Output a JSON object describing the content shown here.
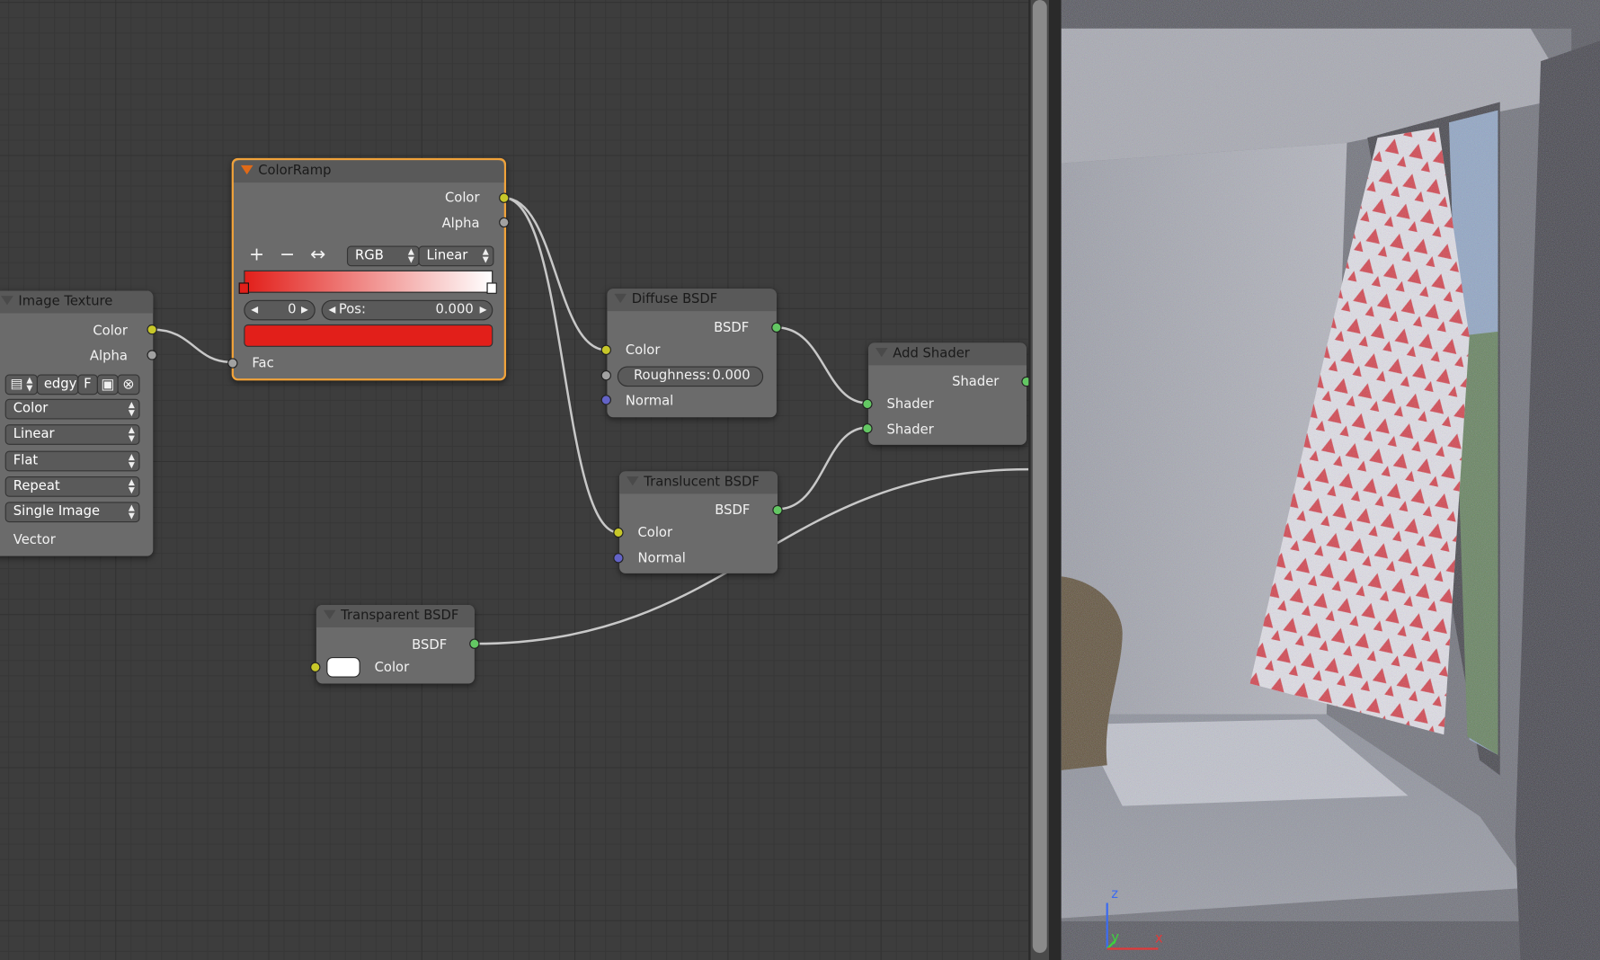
{
  "wire_color": "#c8c8c8",
  "nodes": {
    "image_texture": {
      "title": "Image Texture",
      "outputs": [
        "Color",
        "Alpha"
      ],
      "image_name": "edgy",
      "fake_user": "F",
      "dropdowns": [
        "Color",
        "Linear",
        "Flat",
        "Repeat",
        "Single Image"
      ],
      "inputs": [
        "Vector"
      ]
    },
    "color_ramp": {
      "title": "ColorRamp",
      "outputs": [
        "Color",
        "Alpha"
      ],
      "add_icon": "+",
      "remove_icon": "−",
      "flip_icon": "↔",
      "color_mode": "RGB",
      "interpolation": "Linear",
      "active_stop": "0",
      "pos_label": "Pos:",
      "pos_value": "0.000",
      "stop_color": "#e21f1a",
      "gradient_start": "#e21f1a",
      "gradient_end": "#ffffff",
      "inputs": [
        "Fac"
      ]
    },
    "diffuse_bsdf": {
      "title": "Diffuse BSDF",
      "outputs": [
        "BSDF"
      ],
      "inputs": [
        "Color",
        "Normal"
      ],
      "roughness_label": "Roughness:",
      "roughness_value": "0.000"
    },
    "translucent_bsdf": {
      "title": "Translucent BSDF",
      "outputs": [
        "BSDF"
      ],
      "inputs": [
        "Color",
        "Normal"
      ]
    },
    "add_shader": {
      "title": "Add Shader",
      "outputs": [
        "Shader"
      ],
      "inputs": [
        "Shader",
        "Shader"
      ]
    },
    "transparent_bsdf": {
      "title": "Transparent BSDF",
      "outputs": [
        "BSDF"
      ],
      "inputs": [
        "Color"
      ],
      "color_swatch": "#ffffff"
    }
  },
  "viewport": {
    "axis_labels": {
      "z": "z",
      "y": "y",
      "x": "x"
    },
    "axis_colors": {
      "z": "#3d6cf0",
      "y": "#3dd13d",
      "x": "#e03a3a"
    }
  }
}
